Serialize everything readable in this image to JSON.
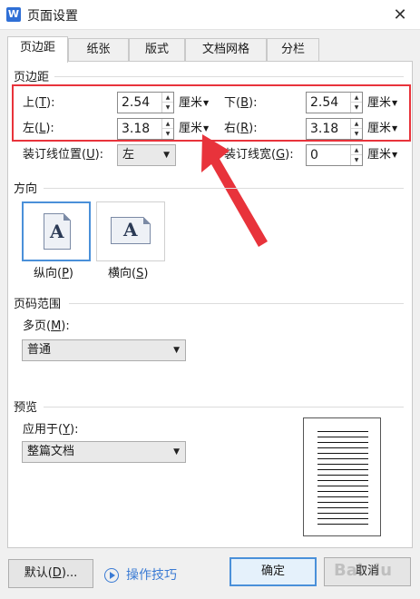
{
  "window": {
    "title": "页面设置",
    "app_icon_letter": "W"
  },
  "tabs": [
    {
      "label": "页边距",
      "active": true
    },
    {
      "label": "纸张",
      "active": false
    },
    {
      "label": "版式",
      "active": false
    },
    {
      "label": "文档网格",
      "active": false
    },
    {
      "label": "分栏",
      "active": false
    }
  ],
  "margins": {
    "group_title": "页边距",
    "top": {
      "label": "上(",
      "key": "T",
      "suffix": "):",
      "value": "2.54",
      "unit": "厘米"
    },
    "bottom": {
      "label": "下(",
      "key": "B",
      "suffix": "):",
      "value": "2.54",
      "unit": "厘米"
    },
    "left": {
      "label": "左(",
      "key": "L",
      "suffix": "):",
      "value": "3.18",
      "unit": "厘米"
    },
    "right": {
      "label": "右(",
      "key": "R",
      "suffix": "):",
      "value": "3.18",
      "unit": "厘米"
    },
    "gutter_pos": {
      "label": "装订线位置(",
      "key": "U",
      "suffix": "):",
      "value": "左"
    },
    "gutter_width": {
      "label": "装订线宽(",
      "key": "G",
      "suffix": "):",
      "value": "0",
      "unit": "厘米"
    }
  },
  "orientation": {
    "group_title": "方向",
    "portrait": {
      "label": "纵向(",
      "key": "P",
      "suffix": ")",
      "letter": "A",
      "selected": true
    },
    "landscape": {
      "label": "横向(",
      "key": "S",
      "suffix": ")",
      "letter": "A",
      "selected": false
    }
  },
  "page_range": {
    "group_title": "页码范围",
    "multi_label": "多页(",
    "multi_key": "M",
    "multi_suffix": "):",
    "value": "普通"
  },
  "preview": {
    "group_title": "预览",
    "apply_label": "应用于(",
    "apply_key": "Y",
    "apply_suffix": "):",
    "apply_value": "整篇文档"
  },
  "footer": {
    "default_label": "默认(",
    "default_key": "D",
    "default_suffix": ")...",
    "tips_label": "操作技巧",
    "ok_label": "确定",
    "cancel_label": "取消"
  },
  "watermark_text": "Bai du",
  "colors": {
    "highlight": "#e8333b",
    "accent": "#4a90d9",
    "link": "#3b7bd4"
  },
  "icons": {
    "close": "close-icon",
    "spin_up": "spin-up-icon",
    "spin_down": "spin-down-icon",
    "dropdown": "dropdown-icon",
    "play": "play-circle-icon"
  }
}
